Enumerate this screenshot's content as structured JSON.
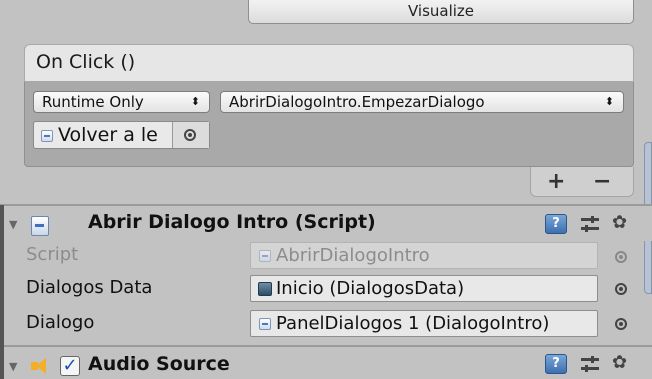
{
  "top_button": {
    "label": "Visualize"
  },
  "on_click": {
    "header": "On Click ()",
    "runtime_dropdown": {
      "selected": "Runtime Only",
      "arrow": "⬍"
    },
    "method_dropdown": {
      "selected": "AbrirDialogoIntro.EmpezarDialogo",
      "arrow": "⬍"
    },
    "target_object": "Volver a le",
    "add_label": "+",
    "remove_label": "−"
  },
  "component": {
    "title": "Abrir Dialogo Intro (Script)",
    "help": "?",
    "gear": "✿",
    "fold": "▼",
    "properties": [
      {
        "label": "Script",
        "value": "AbrirDialogoIntro",
        "disabled": true
      },
      {
        "label": "Dialogos Data",
        "value": "Inicio (DialogosData)",
        "disabled": false
      },
      {
        "label": "Dialogo",
        "value": "PanelDialogos 1 (DialogoIntro)",
        "disabled": false
      }
    ]
  },
  "audio_component": {
    "title": "Audio Source",
    "enabled": true,
    "check": "✓",
    "help": "?",
    "gear": "✿",
    "fold": "▼"
  },
  "colors": {
    "panel_bg": "#c2c2c2",
    "event_body": "#a9a9a9",
    "field_bg": "#e8e8e8",
    "help_blue": "#3e6fae",
    "speaker_orange": "#f2b02a"
  },
  "icons": {
    "script": "script-icon",
    "object": "gameobject-icon",
    "data": "scriptable-object-icon",
    "picker": "object-picker-icon",
    "preset": "preset-sliders-icon",
    "gear": "gear-icon",
    "speaker": "speaker-icon"
  }
}
